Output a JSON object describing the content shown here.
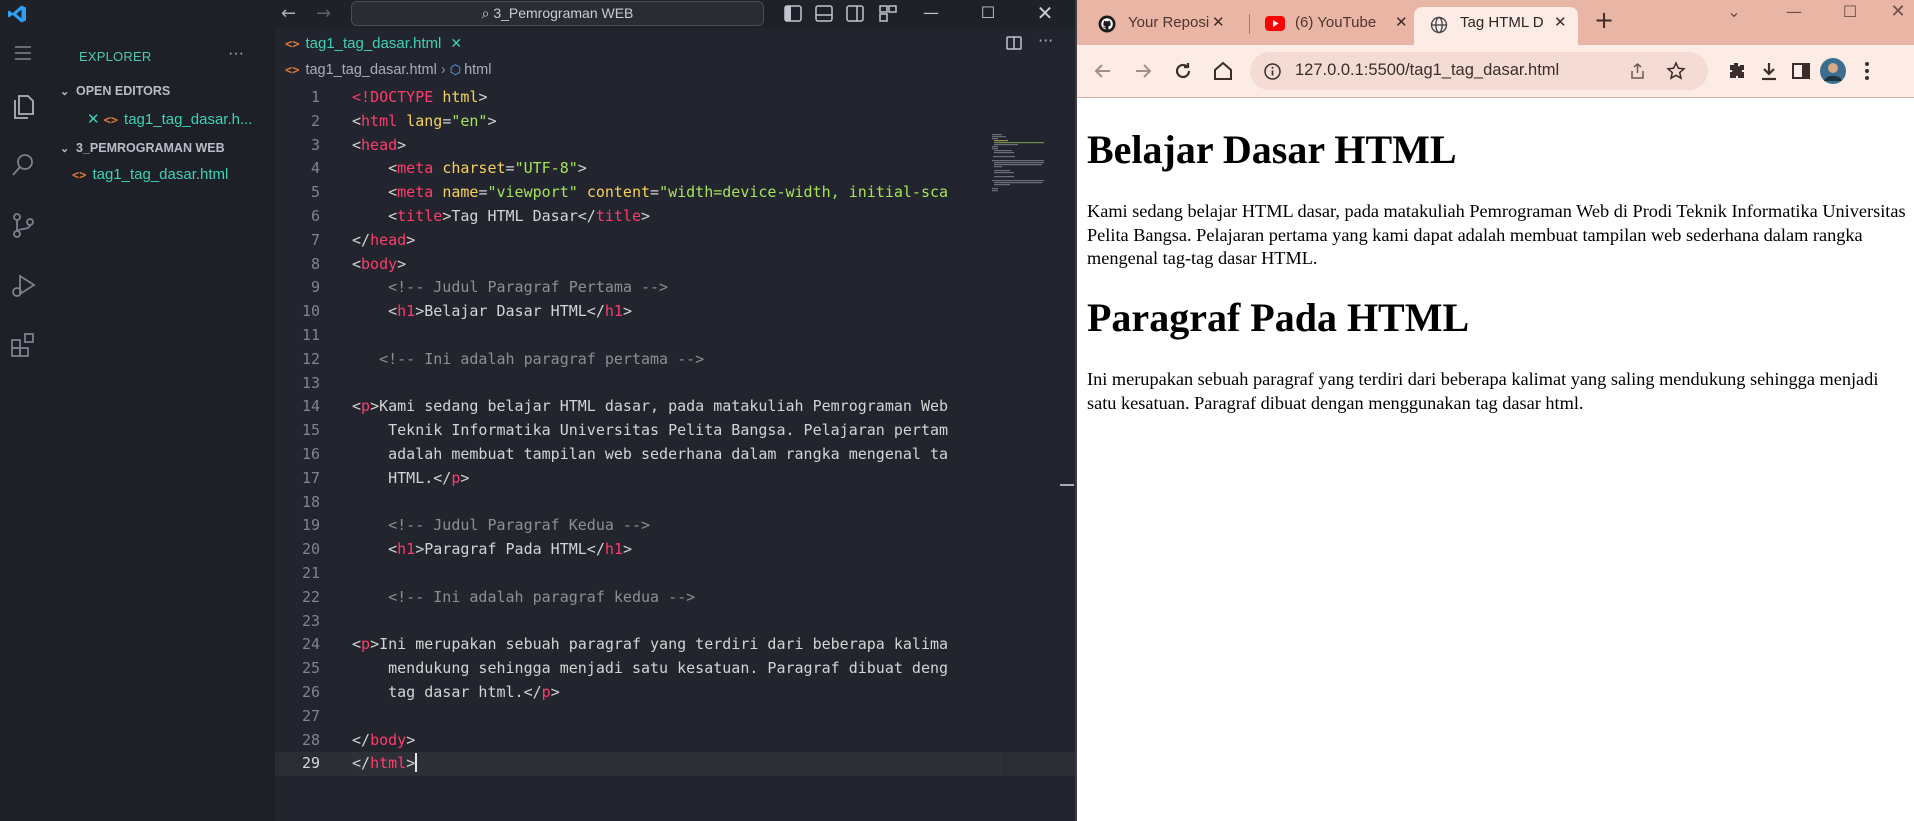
{
  "vscode": {
    "search_label": "3_Pemrograman WEB",
    "explorer_title": "EXPLORER",
    "open_editors_title": "OPEN EDITORS",
    "open_editor_file": "tag1_tag_dasar.h...",
    "folder_title": "3_PEMROGRAMAN WEB",
    "folder_file": "tag1_tag_dasar.html",
    "tab_label": "tag1_tag_dasar.html",
    "breadcrumb_file": "tag1_tag_dasar.html",
    "breadcrumb_symbol": "html",
    "active_line": 29,
    "code_lines": [
      [
        [
          "doc",
          "<!"
        ],
        [
          "tag",
          "DOCTYPE"
        ],
        [
          "plain",
          " "
        ],
        [
          "attr",
          "html"
        ],
        [
          "plain",
          ">"
        ]
      ],
      [
        [
          "plain",
          "<"
        ],
        [
          "tag",
          "html"
        ],
        [
          "plain",
          " "
        ],
        [
          "attr",
          "lang"
        ],
        [
          "plain",
          "="
        ],
        [
          "str",
          "\"en\""
        ],
        [
          "plain",
          ">"
        ]
      ],
      [
        [
          "plain",
          "<"
        ],
        [
          "tag",
          "head"
        ],
        [
          "plain",
          ">"
        ]
      ],
      [
        [
          "plain",
          "    <"
        ],
        [
          "tag",
          "meta"
        ],
        [
          "plain",
          " "
        ],
        [
          "attr",
          "charset"
        ],
        [
          "plain",
          "="
        ],
        [
          "str",
          "\"UTF-8\""
        ],
        [
          "plain",
          ">"
        ]
      ],
      [
        [
          "plain",
          "    <"
        ],
        [
          "tag",
          "meta"
        ],
        [
          "plain",
          " "
        ],
        [
          "attr",
          "name"
        ],
        [
          "plain",
          "="
        ],
        [
          "str",
          "\"viewport\""
        ],
        [
          "plain",
          " "
        ],
        [
          "attr",
          "content"
        ],
        [
          "plain",
          "="
        ],
        [
          "str",
          "\"width=device-width, initial-sca"
        ]
      ],
      [
        [
          "plain",
          "    <"
        ],
        [
          "tag",
          "title"
        ],
        [
          "plain",
          ">Tag HTML Dasar</"
        ],
        [
          "tag",
          "title"
        ],
        [
          "plain",
          ">"
        ]
      ],
      [
        [
          "plain",
          "</"
        ],
        [
          "tag",
          "head"
        ],
        [
          "plain",
          ">"
        ]
      ],
      [
        [
          "plain",
          "<"
        ],
        [
          "tag",
          "body"
        ],
        [
          "plain",
          ">"
        ]
      ],
      [
        [
          "cmt",
          "    <!-- Judul Paragraf Pertama -->"
        ]
      ],
      [
        [
          "plain",
          "    <"
        ],
        [
          "tag",
          "h1"
        ],
        [
          "plain",
          ">Belajar Dasar HTML</"
        ],
        [
          "tag",
          "h1"
        ],
        [
          "plain",
          ">"
        ]
      ],
      [
        [
          "plain",
          ""
        ]
      ],
      [
        [
          "cmt",
          "   <!-- Ini adalah paragraf pertama -->"
        ]
      ],
      [
        [
          "plain",
          ""
        ]
      ],
      [
        [
          "plain",
          "<"
        ],
        [
          "tag",
          "p"
        ],
        [
          "plain",
          ">Kami sedang belajar HTML dasar, pada matakuliah Pemrograman Web"
        ]
      ],
      [
        [
          "plain",
          "    Teknik Informatika Universitas Pelita Bangsa. Pelajaran pertam"
        ]
      ],
      [
        [
          "plain",
          "    adalah membuat tampilan web sederhana dalam rangka mengenal ta"
        ]
      ],
      [
        [
          "plain",
          "    HTML.</"
        ],
        [
          "tag",
          "p"
        ],
        [
          "plain",
          ">"
        ]
      ],
      [
        [
          "plain",
          ""
        ]
      ],
      [
        [
          "cmt",
          "    <!-- Judul Paragraf Kedua -->"
        ]
      ],
      [
        [
          "plain",
          "    <"
        ],
        [
          "tag",
          "h1"
        ],
        [
          "plain",
          ">Paragraf Pada HTML</"
        ],
        [
          "tag",
          "h1"
        ],
        [
          "plain",
          ">"
        ]
      ],
      [
        [
          "plain",
          ""
        ]
      ],
      [
        [
          "cmt",
          "    <!-- Ini adalah paragraf kedua -->"
        ]
      ],
      [
        [
          "plain",
          ""
        ]
      ],
      [
        [
          "plain",
          "<"
        ],
        [
          "tag",
          "p"
        ],
        [
          "plain",
          ">Ini merupakan sebuah paragraf yang terdiri dari beberapa kalima"
        ]
      ],
      [
        [
          "plain",
          "    mendukung sehingga menjadi satu kesatuan. Paragraf dibuat deng"
        ]
      ],
      [
        [
          "plain",
          "    tag dasar html.</"
        ],
        [
          "tag",
          "p"
        ],
        [
          "plain",
          ">"
        ]
      ],
      [
        [
          "plain",
          ""
        ]
      ],
      [
        [
          "plain",
          "</"
        ],
        [
          "tag",
          "body"
        ],
        [
          "plain",
          ">"
        ]
      ],
      [
        [
          "plain",
          "</"
        ],
        [
          "tag",
          "html"
        ],
        [
          "plain",
          ">"
        ]
      ]
    ],
    "colors": {
      "tag": "#ff3b6b",
      "attr": "#f7d15a",
      "string": "#a6e25a",
      "comment": "#8d8d96",
      "accent": "#3fd0b5"
    }
  },
  "chrome": {
    "tabs": [
      {
        "label": "Your Reposi",
        "icon": "github-icon"
      },
      {
        "label": "(6) YouTube",
        "icon": "youtube-icon"
      },
      {
        "label": "Tag HTML D",
        "icon": "globe-icon",
        "active": true
      }
    ],
    "url": "127.0.0.1:5500/tag1_tag_dasar.html",
    "page": {
      "h1_first": "Belajar Dasar HTML",
      "p_first": "Kami sedang belajar HTML dasar, pada matakuliah Pemrograman Web di Prodi Teknik Informatika Universitas Pelita Bangsa. Pelajaran pertama yang kami dapat adalah membuat tampilan web sederhana dalam rangka mengenal tag-tag dasar HTML.",
      "h1_second": "Paragraf Pada HTML",
      "p_second": "Ini merupakan sebuah paragraf yang terdiri dari beberapa kalimat yang saling mendukung sehingga menjadi satu kesatuan. Paragraf dibuat dengan menggunakan tag dasar html."
    }
  }
}
